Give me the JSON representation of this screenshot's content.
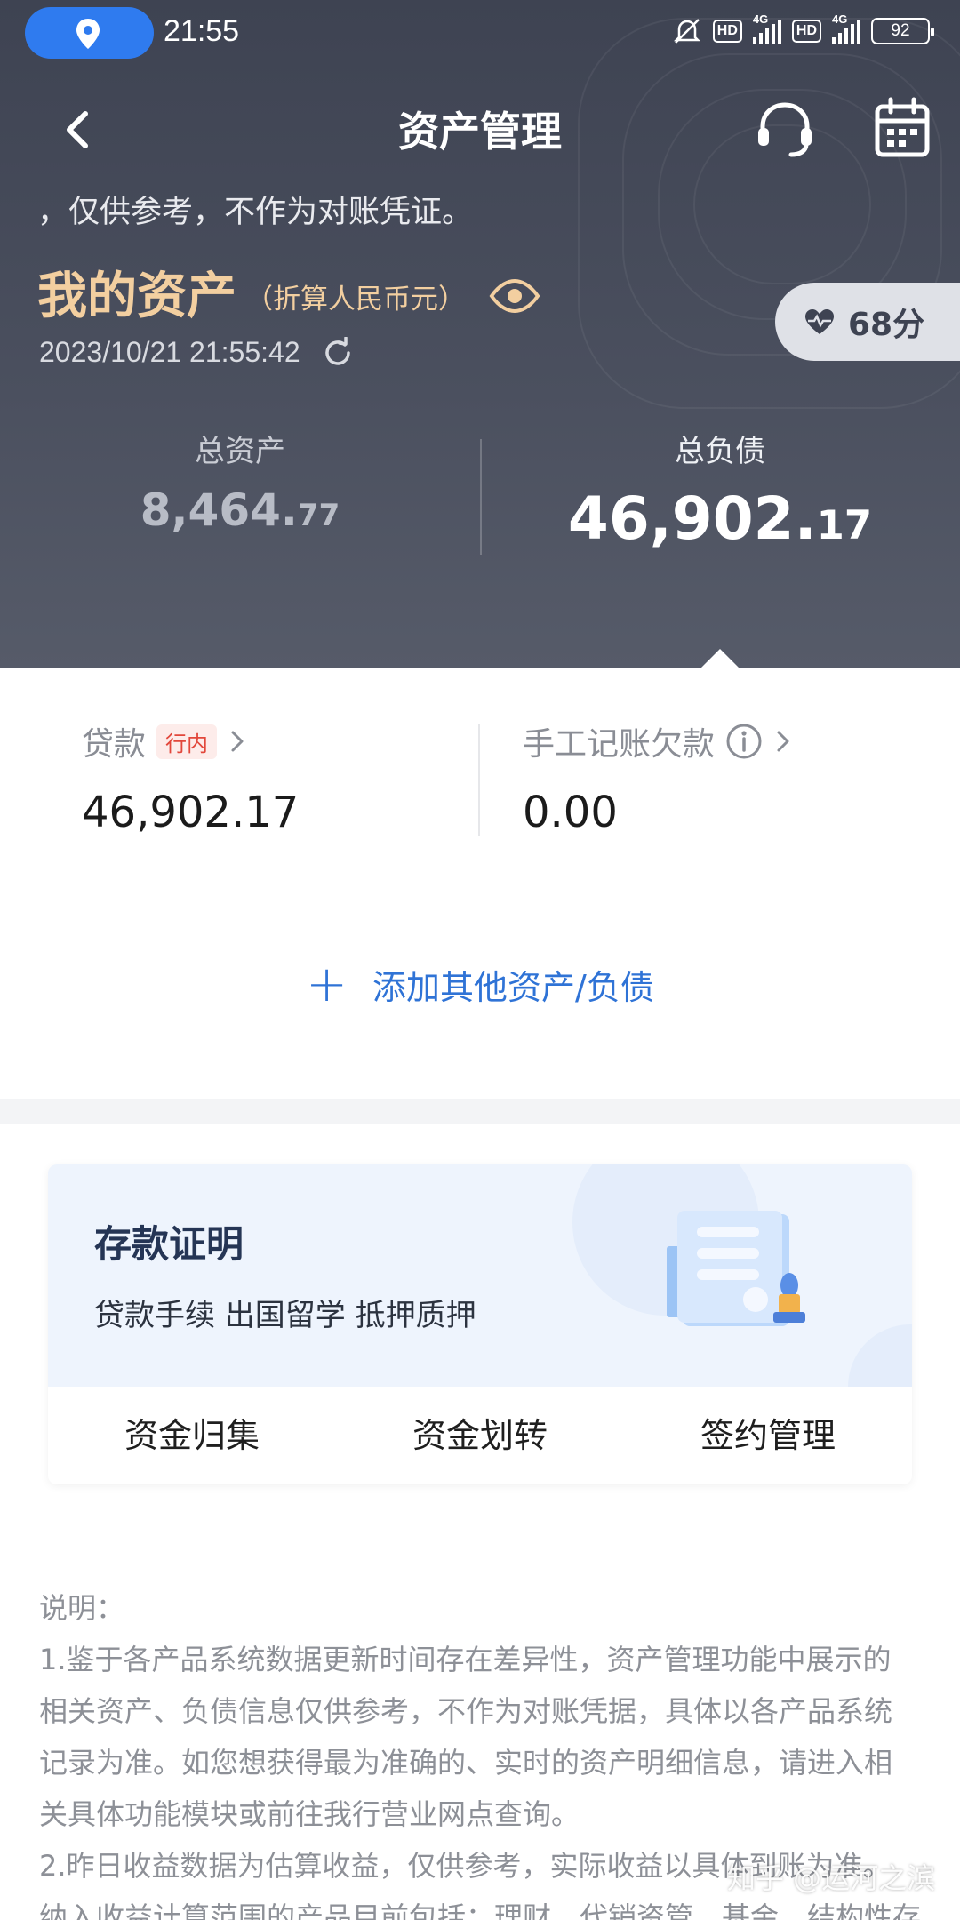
{
  "status_bar": {
    "time": "21:55",
    "hd1": "HD",
    "net1": "4G",
    "hd2": "HD",
    "net2": "4G",
    "battery": "92"
  },
  "nav": {
    "title": "资产管理"
  },
  "header": {
    "notice": "，仅供参考，不作为对账凭证。",
    "my_assets_title": "我的资产",
    "my_assets_unit": "（折算人民币元）",
    "timestamp": "2023/10/21 21:55:42",
    "score": "68分"
  },
  "totals": {
    "assets_label": "总资产",
    "assets_int": "8,464.",
    "assets_dec": "77",
    "liabilities_label": "总负债",
    "liabilities_int": "46,902.",
    "liabilities_dec": "17"
  },
  "liabilities": {
    "loan_label": "贷款",
    "loan_tag": "行内",
    "loan_value": "46,902.17",
    "manual_label": "手工记账欠款",
    "manual_value": "0.00",
    "add_label": "添加其他资产/负债"
  },
  "deposit_card": {
    "title": "存款证明",
    "subtitle": "贷款手续 出国留学 抵押质押",
    "actions": [
      "资金归集",
      "资金划转",
      "签约管理"
    ]
  },
  "notes": [
    "说明：",
    "1.鉴于各产品系统数据更新时间存在差异性，资产管理功能中展示的",
    "相关资产、负债信息仅供参考，不作为对账凭据，具体以各产品系统",
    "记录为准。如您想获得最为准确的、实时的资产明细信息，请进入相",
    "关具体功能模块或前往我行营业网点查询。",
    "2.昨日收益数据为估算收益，仅供参考，实际收益以具体到账为准。",
    "纳入收益计算范围的产品目前包括：理财、代销资管、基金、结构性存"
  ],
  "watermark": "知乎 @运河之滨",
  "colors": {
    "header_bg": "#474c5b",
    "accent_gold": "#f3cfa0",
    "link_blue": "#2f73d6",
    "tag_red": "#e2473b"
  }
}
